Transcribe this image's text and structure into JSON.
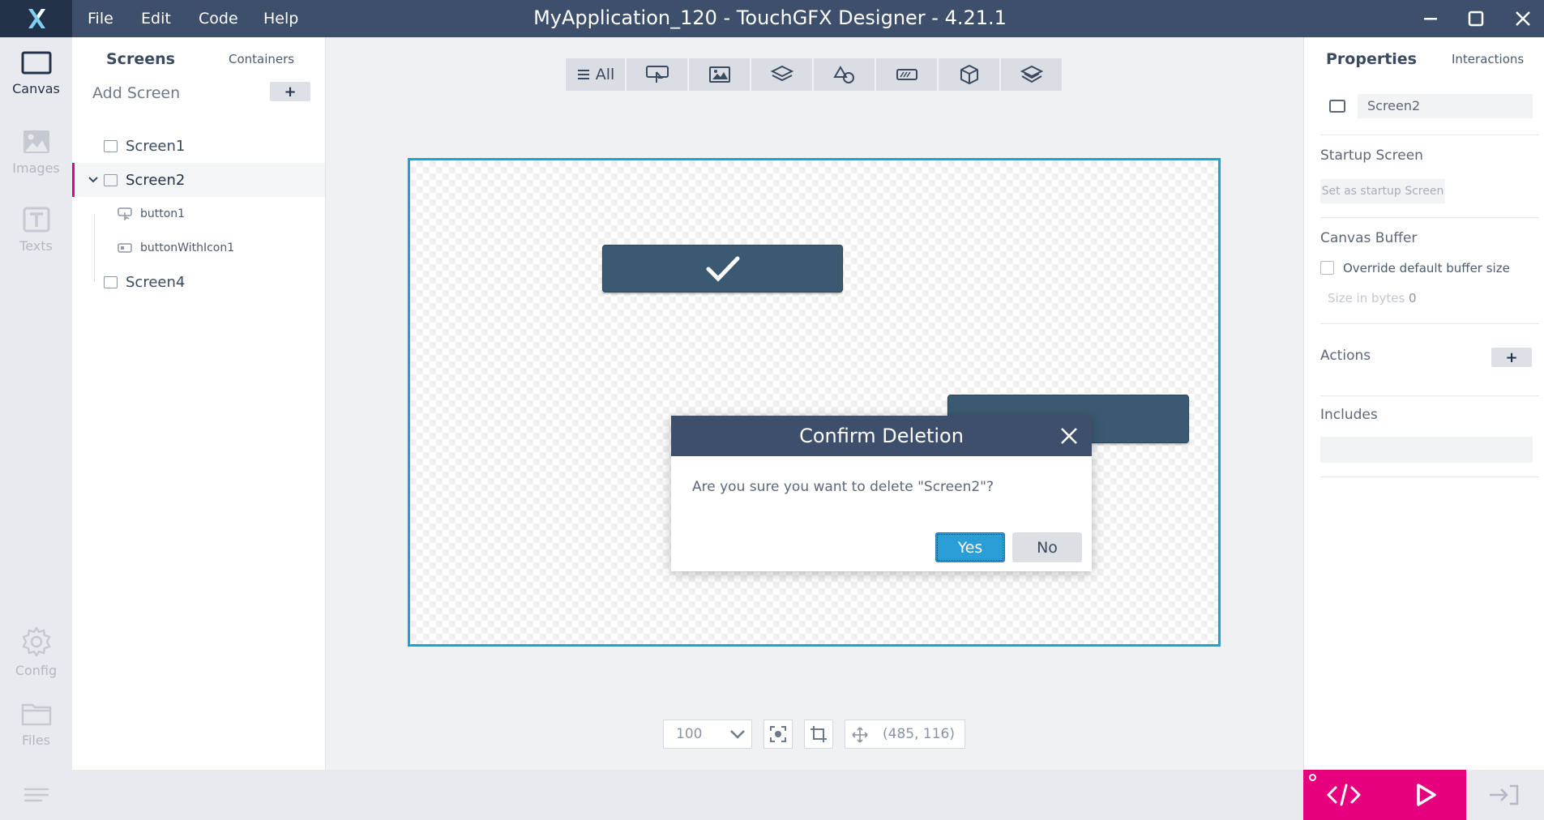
{
  "window": {
    "title": "MyApplication_120 - TouchGFX Designer - 4.21.1",
    "menu": [
      "File",
      "Edit",
      "Code",
      "Help"
    ],
    "logo_icon": "touchgfx-x-logo",
    "controls": [
      "minimize-icon",
      "maximize-icon",
      "close-icon"
    ]
  },
  "leftnav": {
    "items": [
      {
        "label": "Canvas",
        "icon": "canvas-icon",
        "active": true
      },
      {
        "label": "Images",
        "icon": "image-icon",
        "active": false
      },
      {
        "label": "Texts",
        "icon": "text-icon",
        "active": false
      },
      {
        "label": "Config",
        "icon": "gear-icon",
        "active": false
      },
      {
        "label": "Files",
        "icon": "folder-icon",
        "active": false
      }
    ]
  },
  "screens_panel": {
    "tabs": {
      "screens": "Screens",
      "containers": "Containers"
    },
    "add_screen_label": "Add Screen",
    "add_button": "+",
    "tree": [
      {
        "label": "Screen1"
      },
      {
        "label": "Screen2",
        "expanded": true,
        "selected": true,
        "children": [
          {
            "label": "button1",
            "icon": "button-icon"
          },
          {
            "label": "buttonWithIcon1",
            "icon": "button-with-icon-icon"
          }
        ]
      },
      {
        "label": "Screen4"
      }
    ]
  },
  "widget_toolbar": {
    "all_label": "All",
    "categories": [
      "all-icon",
      "buttons-icon",
      "images-icon",
      "containers-icon",
      "shapes-icon",
      "progress-icon",
      "3d-icon",
      "layers-icon"
    ]
  },
  "canvas": {
    "button1_icon": "checkmark-icon"
  },
  "dialog": {
    "title": "Confirm Deletion",
    "message": "Are you sure you want to delete \"Screen2\"?",
    "yes": "Yes",
    "no": "No"
  },
  "canvas_toolbar": {
    "zoom": "100",
    "coords": "(485, 116)"
  },
  "properties_panel": {
    "tabs": {
      "properties": "Properties",
      "interactions": "Interactions"
    },
    "name": "Screen2",
    "startup_section": "Startup Screen",
    "startup_button": "Set as startup Screen",
    "canvas_buffer_section": "Canvas Buffer",
    "override_label": "Override default buffer size",
    "size_label": "Size in bytes",
    "size_value": "0",
    "actions_section": "Actions",
    "actions_add": "+",
    "includes_section": "Includes"
  },
  "colors": {
    "titlebar": "#3d4f6a",
    "accent_pink": "#e6007e",
    "selection_blue": "#1ea1d6",
    "yes_button": "#2a9ed6"
  }
}
